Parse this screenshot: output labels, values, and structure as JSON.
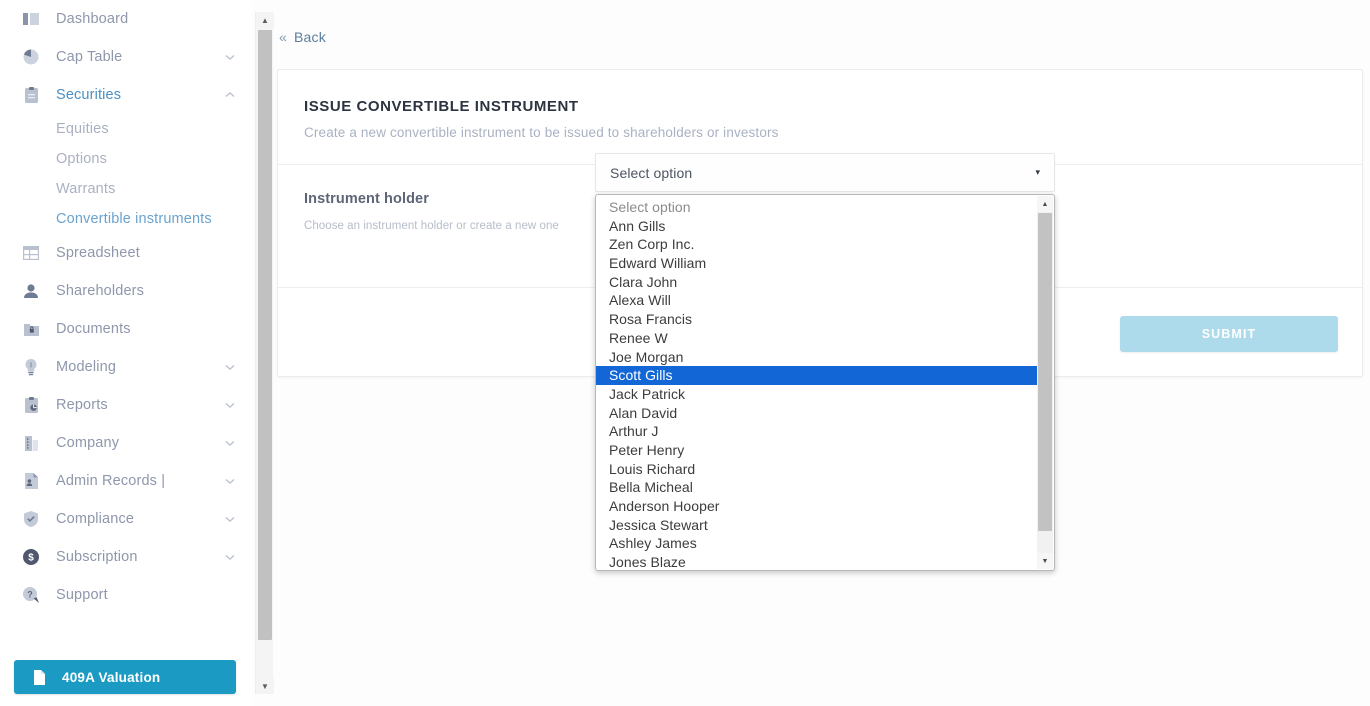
{
  "sidebar": {
    "items": [
      {
        "label": "Dashboard",
        "icon": "bar-chart-icon",
        "chevron": null,
        "active": false
      },
      {
        "label": "Cap Table",
        "icon": "pie-chart-icon",
        "chevron": "chevron-down-icon",
        "active": false
      },
      {
        "label": "Securities",
        "icon": "clipboard-icon",
        "chevron": "chevron-up-icon",
        "active": true
      },
      {
        "label": "Spreadsheet",
        "icon": "table-icon",
        "chevron": null,
        "active": false
      },
      {
        "label": "Shareholders",
        "icon": "user-icon",
        "chevron": null,
        "active": false
      },
      {
        "label": "Documents",
        "icon": "lock-folder-icon",
        "chevron": null,
        "active": false
      },
      {
        "label": "Modeling",
        "icon": "lightbulb-icon",
        "chevron": "chevron-down-icon",
        "active": false
      },
      {
        "label": "Reports",
        "icon": "report-clipboard-icon",
        "chevron": "chevron-down-icon",
        "active": false
      },
      {
        "label": "Company",
        "icon": "building-icon",
        "chevron": "chevron-down-icon",
        "active": false
      },
      {
        "label": "Admin Records |",
        "icon": "admin-file-icon",
        "chevron": "chevron-down-icon",
        "active": false
      },
      {
        "label": "Compliance",
        "icon": "shield-check-icon",
        "chevron": "chevron-down-icon",
        "active": false
      },
      {
        "label": "Subscription",
        "icon": "dollar-circle-icon",
        "chevron": "chevron-down-icon",
        "active": false
      },
      {
        "label": "Support",
        "icon": "help-bubble-icon",
        "chevron": null,
        "active": false
      }
    ],
    "securities_subitems": [
      {
        "label": "Equities",
        "active": false
      },
      {
        "label": "Options",
        "active": false
      },
      {
        "label": "Warrants",
        "active": false
      },
      {
        "label": "Convertible instruments",
        "active": true
      }
    ],
    "valuation_button": {
      "label": "409A Valuation",
      "icon": "document-icon",
      "color": "#1b9bc4"
    }
  },
  "main": {
    "back_link": {
      "label": "Back",
      "glyph": "«"
    },
    "card": {
      "title": "ISSUE CONVERTIBLE INSTRUMENT",
      "subtitle": "Create a new convertible instrument to be issued to shareholders or investors",
      "field": {
        "label": "Instrument holder",
        "help": "Choose an instrument holder or create a new one"
      },
      "submit_label": "SUBMIT",
      "submit_color": "#aedbeb"
    }
  },
  "select": {
    "value": "Select option",
    "caret": "▾",
    "expanded": true,
    "highlight_color": "#1266d6",
    "selected_option": "Scott Gills",
    "options": [
      "Select option",
      "Ann Gills",
      "Zen Corp Inc.",
      "Edward William",
      "Clara John",
      "Alexa Will",
      "Rosa Francis",
      "Renee W",
      "Joe Morgan",
      "Scott Gills",
      "Jack Patrick",
      "Alan David",
      "Arthur J",
      "Peter Henry",
      "Louis Richard",
      "Bella Micheal",
      "Anderson Hooper",
      "Jessica Stewart",
      "Ashley James",
      "Jones Blaze"
    ]
  },
  "scrollbars": {
    "up_glyph": "▲",
    "down_glyph": "▼"
  }
}
